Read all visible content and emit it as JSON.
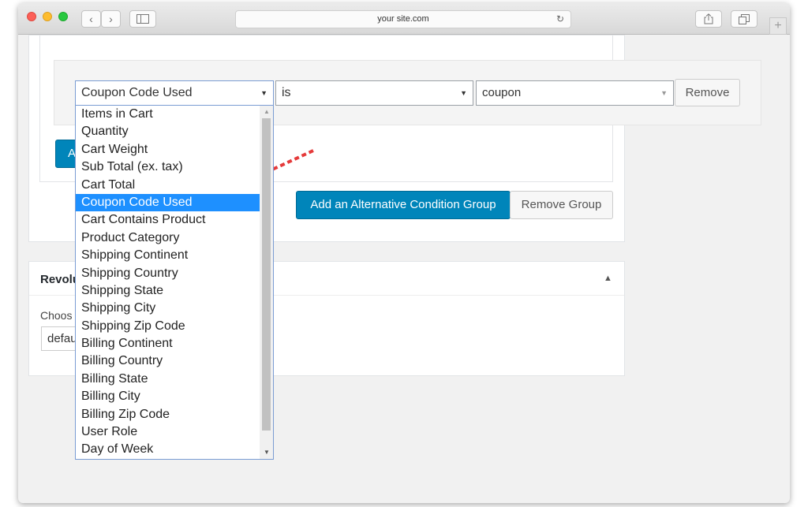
{
  "browser": {
    "url": "your site.com"
  },
  "condition": {
    "field_selected": "Coupon Code Used",
    "operator_selected": "is",
    "value_selected": "coupon",
    "remove_label": "Remove"
  },
  "group": {
    "add_alt_label": "Add an Alternative Condition Group",
    "remove_group_label": "Remove Group",
    "partial_add_label": "A"
  },
  "panel2": {
    "title_partial": "Revolu",
    "choose_partial": "Choos",
    "select_partial": "defau"
  },
  "dropdown": {
    "options": [
      "Items in Cart",
      "Quantity",
      "Cart Weight",
      "Sub Total (ex. tax)",
      "Cart Total",
      "Coupon Code Used",
      "Cart Contains Product",
      "Product Category",
      "Shipping Continent",
      "Shipping Country",
      "Shipping State",
      "Shipping City",
      "Shipping Zip Code",
      "Billing Continent",
      "Billing Country",
      "Billing State",
      "Billing City",
      "Billing Zip Code",
      "User Role",
      "Day of Week"
    ],
    "selected_index": 5
  },
  "colors": {
    "accent": "#0085ba",
    "selected_option": "#1e90ff",
    "annotation_arrow": "#e53a3a"
  }
}
